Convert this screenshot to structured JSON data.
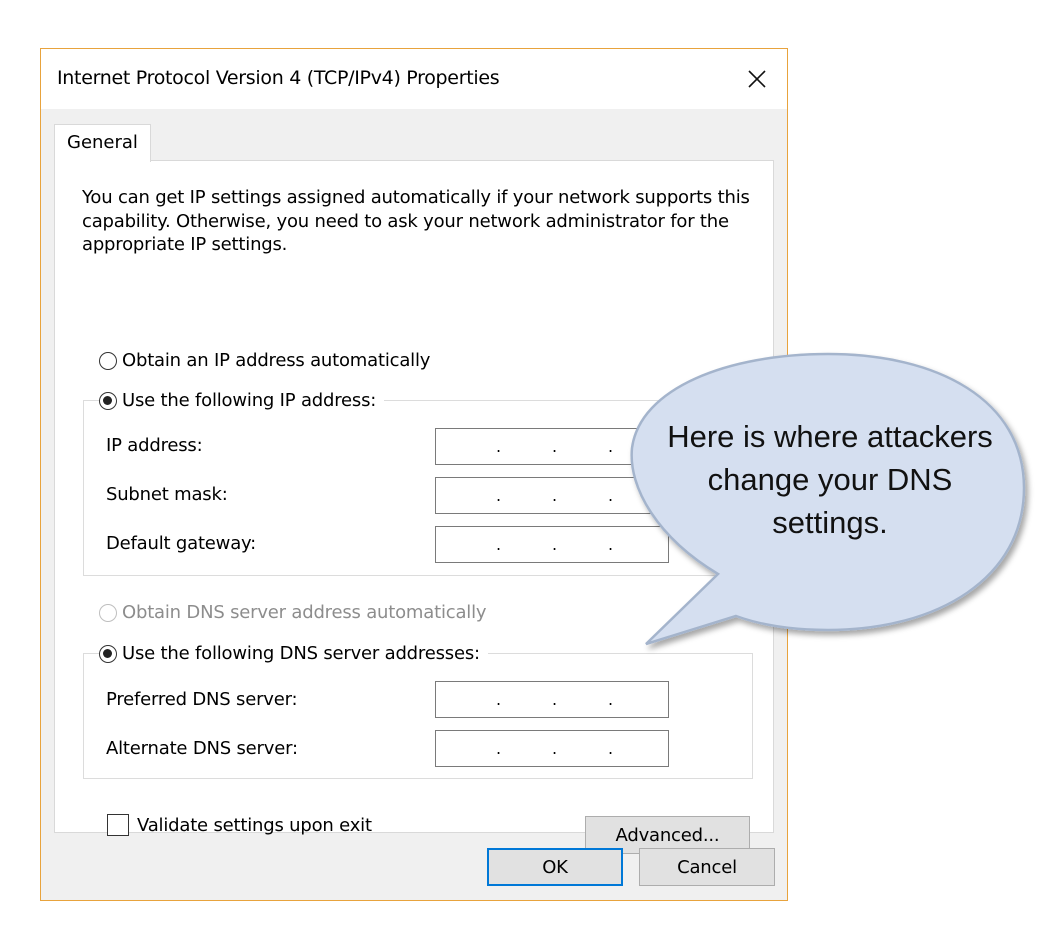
{
  "window": {
    "title": "Internet Protocol Version 4 (TCP/IPv4) Properties",
    "close_icon": "close-icon"
  },
  "tabs": [
    {
      "label": "General",
      "active": true
    }
  ],
  "intro_text": "You can get IP settings assigned automatically if your network supports this capability. Otherwise, you need to ask your network administrator for the appropriate IP settings.",
  "ip_section": {
    "auto_option": {
      "label": "Obtain an IP address automatically",
      "selected": false
    },
    "manual_option": {
      "label": "Use the following IP address:",
      "selected": true
    },
    "fields": {
      "ip_address": {
        "label": "IP address:",
        "value": ""
      },
      "subnet_mask": {
        "label": "Subnet mask:",
        "value": ""
      },
      "default_gateway": {
        "label": "Default gateway:",
        "value": ""
      }
    }
  },
  "dns_section": {
    "auto_option": {
      "label": "Obtain DNS server address automatically",
      "selected": false,
      "disabled": true
    },
    "manual_option": {
      "label": "Use the following DNS server addresses:",
      "selected": true
    },
    "fields": {
      "preferred": {
        "label": "Preferred DNS server:",
        "value": ""
      },
      "alternate": {
        "label": "Alternate DNS server:",
        "value": ""
      }
    }
  },
  "validate_checkbox": {
    "label": "Validate settings upon exit",
    "checked": false
  },
  "buttons": {
    "advanced": "Advanced...",
    "ok": "OK",
    "cancel": "Cancel"
  },
  "callout": {
    "text": "Here is where attackers change your DNS settings.",
    "fill_color": "#d5dff0",
    "stroke_color": "#a4b4cc"
  },
  "colors": {
    "window_border": "#e8a33d",
    "default_button_border": "#0078d7"
  }
}
